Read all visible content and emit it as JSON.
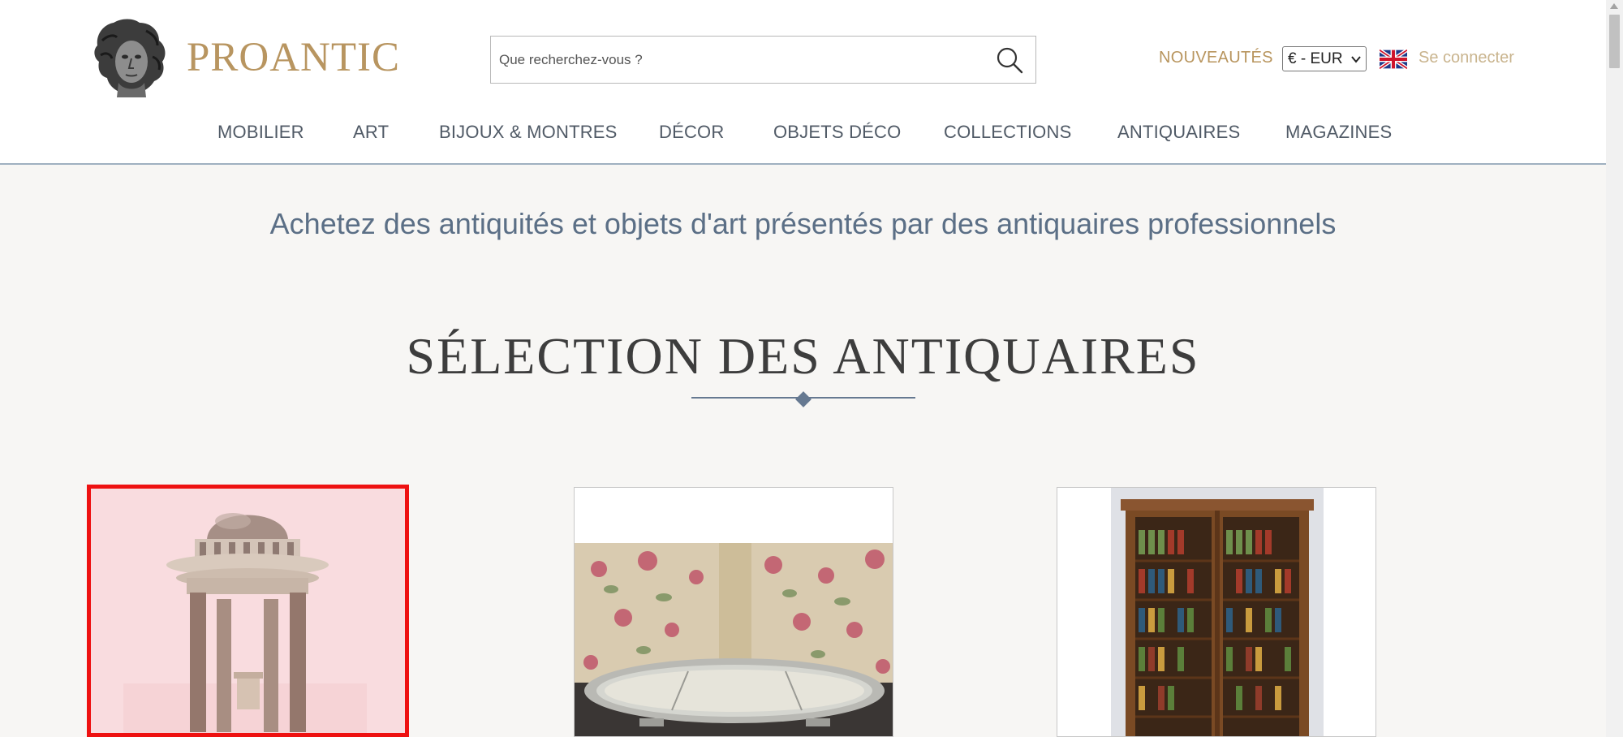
{
  "header": {
    "logo_text": "PROANTIC",
    "search_placeholder": "Que recherchez-vous ?",
    "nouveautes_label": "NOUVEAUTÉS",
    "currency_selected": "€ - EUR",
    "login_label": "Se connecter",
    "accent_color": "#b8955e"
  },
  "nav": {
    "items": [
      {
        "label": "MOBILIER"
      },
      {
        "label": "ART"
      },
      {
        "label": "BIJOUX & MONTRES"
      },
      {
        "label": "DÉCOR"
      },
      {
        "label": "OBJETS DÉCO"
      },
      {
        "label": "COLLECTIONS"
      },
      {
        "label": "ANTIQUAIRES"
      },
      {
        "label": "MAGAZINES"
      }
    ]
  },
  "main": {
    "tagline": "Achetez des antiquités et objets d'art présentés par des antiquaires professionnels",
    "section_title": "SÉLECTION DES ANTIQUAIRES",
    "cards": [
      {
        "image_icon": "marble-temple-image",
        "highlighted": true
      },
      {
        "image_icon": "silver-mirror-tray-image",
        "highlighted": false
      },
      {
        "image_icon": "bookcase-cabinet-image",
        "highlighted": false
      }
    ]
  },
  "icons": {
    "search": "search-icon",
    "flag": "uk-flag-icon",
    "chevron": "chevron-down-icon"
  }
}
